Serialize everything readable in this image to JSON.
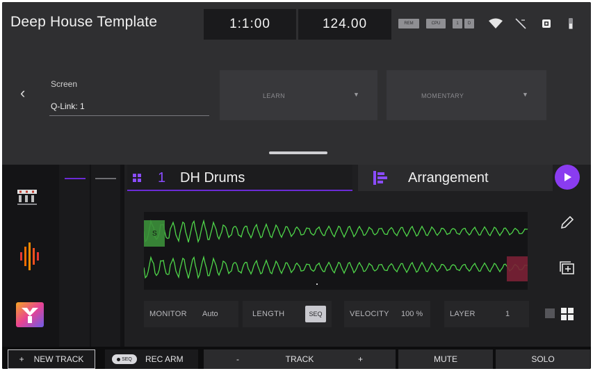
{
  "topbar": {
    "project_title": "Deep House Template",
    "time_position": "1:1:00",
    "tempo": "124.00",
    "status_chips": [
      "REM",
      "CPU",
      "1",
      "D"
    ]
  },
  "qlink_panel": {
    "field_label": "Screen",
    "field_value": "Q-Link: 1",
    "learn_label": "LEARN",
    "mode_label": "MOMENTARY"
  },
  "track": {
    "number": "1",
    "name": "DH Drums"
  },
  "arrangement": {
    "label": "Arrangement"
  },
  "clip": {
    "start_marker": "S"
  },
  "params": {
    "monitor_label": "MONITOR",
    "monitor_value": "Auto",
    "length_label": "LENGTH",
    "length_value": "SEQ",
    "velocity_label": "VELOCITY",
    "velocity_value": "100 %",
    "layer_label": "LAYER",
    "layer_value": "1"
  },
  "bottombar": {
    "new_track_icon": "+",
    "new_track_label": "NEW TRACK",
    "rec_pill": "SEQ",
    "rec_arm_label": "REC ARM",
    "track_minus": "-",
    "track_label": "TRACK",
    "track_plus": "+",
    "mute_label": "MUTE",
    "solo_label": "SOLO"
  },
  "colors": {
    "accent_purple": "#8a3cf0",
    "waveform_green": "#4fd64a",
    "end_marker_red": "#7a2035"
  }
}
